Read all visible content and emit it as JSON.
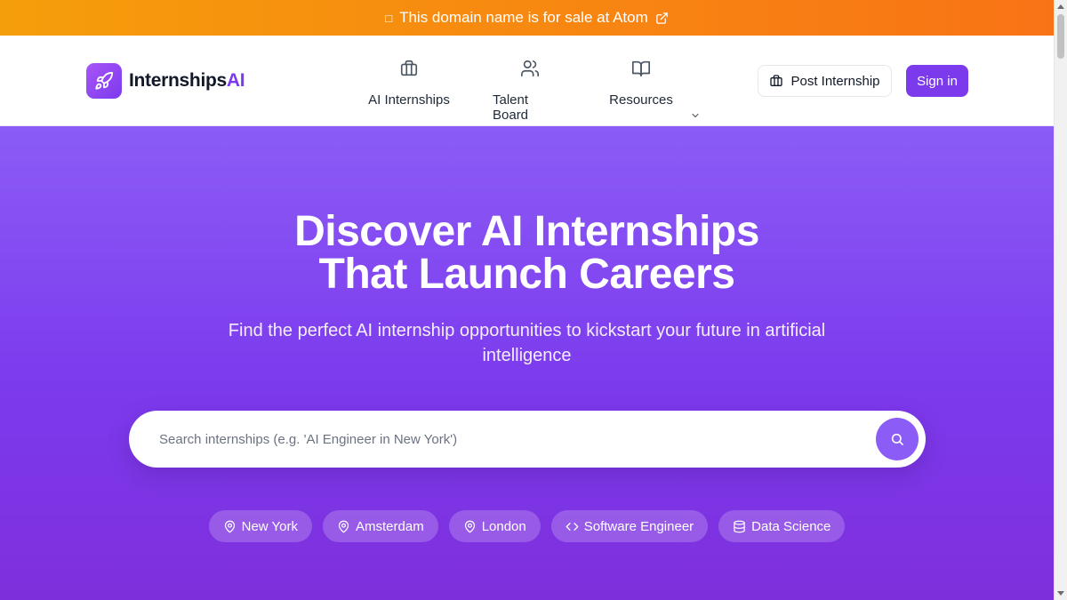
{
  "banner": {
    "glyph": "□",
    "text": "This domain name is for sale at Atom",
    "icon": "external-link-icon"
  },
  "header": {
    "logo": {
      "icon": "rocket-icon",
      "name": "Internships",
      "accent": "AI"
    },
    "nav": [
      {
        "label": "AI Internships",
        "icon": "briefcase-icon"
      },
      {
        "label": "Talent Board",
        "icon": "users-icon"
      },
      {
        "label": "Resources",
        "icon": "book-open-icon"
      }
    ],
    "post_label": "Post Internship",
    "signin_label": "Sign in"
  },
  "hero": {
    "title_line1": "Discover AI Internships",
    "title_line2": "That Launch Careers",
    "subtitle": "Find the perfect AI internship opportunities to kickstart your future in artificial intelligence",
    "search": {
      "placeholder": "Search internships (e.g. 'AI Engineer in New York')",
      "value": ""
    },
    "chips": [
      {
        "label": "New York",
        "icon": "map-pin-icon"
      },
      {
        "label": "Amsterdam",
        "icon": "map-pin-icon"
      },
      {
        "label": "London",
        "icon": "map-pin-icon"
      },
      {
        "label": "Software Engineer",
        "icon": "code-icon"
      },
      {
        "label": "Data Science",
        "icon": "database-icon"
      }
    ]
  },
  "colors": {
    "accent": "#7c3aed",
    "banner_start": "#f59e0b",
    "banner_end": "#f97316",
    "hero_top": "#8b5cf6"
  }
}
